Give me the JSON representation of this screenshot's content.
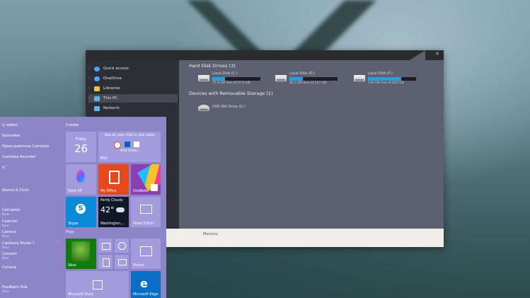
{
  "explorer": {
    "nav": [
      {
        "label": "Quick access",
        "icon": "star-icon",
        "color": "#4aa3ff"
      },
      {
        "label": "OneDrive",
        "icon": "cloud-icon",
        "color": "#4aa3ff"
      },
      {
        "label": "Libraries",
        "icon": "folder-icon",
        "color": "#e8c547"
      },
      {
        "label": "This PC",
        "icon": "computer-icon",
        "color": "#63b3ea"
      },
      {
        "label": "Network",
        "icon": "network-icon",
        "color": "#63b3ea"
      }
    ],
    "hard_disks_title": "Hard Disk Drives (3)",
    "removable_title": "Devices with Removable Storage (1)",
    "drives": [
      {
        "name": "Local Disk (C:)",
        "free": "71.8 GB free of 97.6 GB",
        "used_fraction": 0.26
      },
      {
        "name": "Local Disk (E:)",
        "free": "84.2 GB free of 117 GB",
        "used_fraction": 0.28
      },
      {
        "name": "Local Disk (F:)",
        "free": "149 GB free of 483 GB",
        "used_fraction": 0.69
      }
    ],
    "dvd": {
      "name": "DVD RW Drive (G:)"
    },
    "status": {
      "memory_label": "Memory:"
    }
  },
  "start": {
    "recent_header": "ly added",
    "apps": [
      {
        "label": "Rainmeter"
      },
      {
        "label": "Проигрыватель Camtasia"
      },
      {
        "label": "Camtasia Recorder"
      },
      {
        "label": "d"
      },
      {
        "label": "Alarms & Clock"
      },
      {
        "label": "Calculator",
        "sub": "New"
      },
      {
        "label": "Calendar",
        "sub": "New"
      },
      {
        "label": "Camera",
        "sub": "New"
      },
      {
        "label": "Camtasia Studio 7",
        "sub": "New"
      },
      {
        "label": "Connect",
        "sub": "New"
      },
      {
        "label": "Cortana"
      },
      {
        "label": "Feedback Hub",
        "sub": "New"
      }
    ],
    "create_label": "Create",
    "play_label": "Play",
    "tiles": {
      "calendar": {
        "day": "Friday",
        "date": "26"
      },
      "mail": {
        "line1": "See all your mail in one place",
        "more": "And more...",
        "label": "Mail"
      },
      "paint3d": {
        "label": "Paint 3D"
      },
      "office": {
        "label": "My Office"
      },
      "onenote": {
        "label": "OneNote"
      },
      "skype": {
        "label": "Skype"
      },
      "weather": {
        "condition": "Partly Cloudy",
        "temp": "42°",
        "city": "Washington,..."
      },
      "video": {
        "label": "Video Editor"
      },
      "xbox": {
        "label": "Xbox"
      },
      "photos": {
        "label": "Photos"
      },
      "store": {
        "label": "Microsoft Store"
      },
      "edge": {
        "label": "Microsoft Edge"
      }
    }
  },
  "colors": {
    "accent": "#26a0da",
    "start_bg": "#8e84c8",
    "office": "#e6491d"
  }
}
